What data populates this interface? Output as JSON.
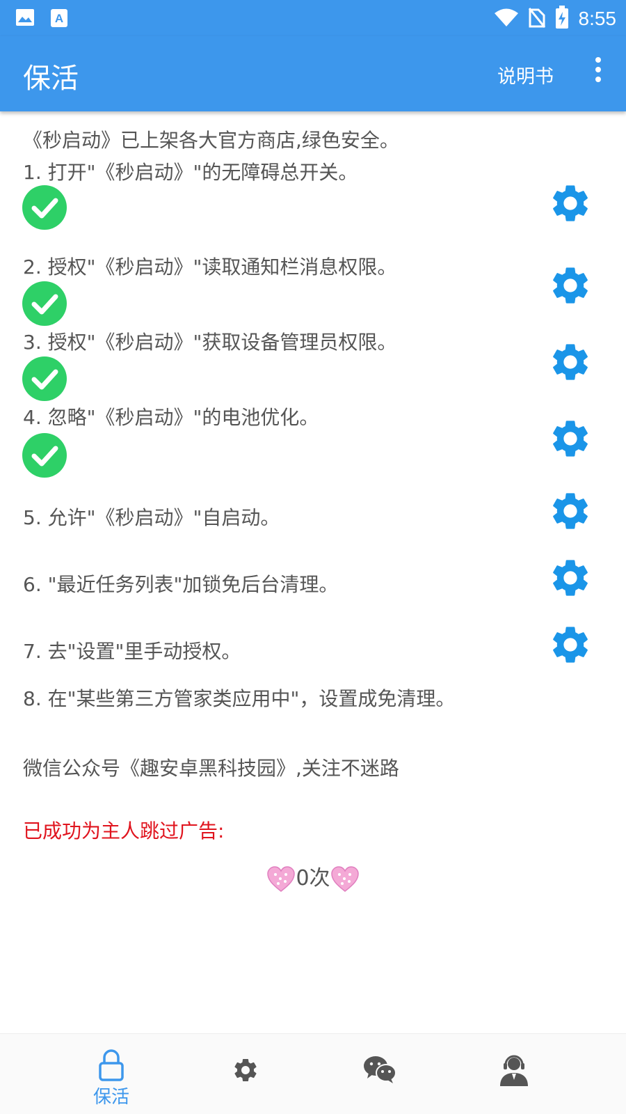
{
  "status_bar": {
    "time": "8:55",
    "icons": [
      "image-notification-icon",
      "font-notification-icon",
      "wifi-icon",
      "no-sim-icon",
      "battery-charging-icon"
    ]
  },
  "app_bar": {
    "title": "保活",
    "manual_label": "说明书",
    "more_icon": "more-vert-icon"
  },
  "content": {
    "intro": "《秒启动》已上架各大官方商店,绿色安全。",
    "steps": [
      {
        "label": "1. 打开\"《秒启动》\"的无障碍总开关。",
        "done": true
      },
      {
        "label": "2. 授权\"《秒启动》\"读取通知栏消息权限。",
        "done": true
      },
      {
        "label": "3. 授权\"《秒启动》\"获取设备管理员权限。",
        "done": true
      },
      {
        "label": "4. 忽略\"《秒启动》\"的电池优化。",
        "done": true
      },
      {
        "label": "5. 允许\"《秒启动》\"自启动。",
        "done": false
      },
      {
        "label": "6. \"最近任务列表\"加锁免后台清理。",
        "done": false
      },
      {
        "label": "7. 去\"设置\"里手动授权。",
        "done": false
      },
      {
        "label": "8. 在\"某些第三方管家类应用中\"，设置成免清理。",
        "done": false
      }
    ],
    "wechat_note": "微信公众号《趣安卓黑科技园》,关注不迷路",
    "skip_ads_label": "已成功为主人跳过广告:",
    "skip_count": "0次"
  },
  "colors": {
    "primary": "#3d97ec",
    "check_green": "#2ed067",
    "gear_blue": "#1a95e8",
    "alert_red": "#e0141e",
    "text_gray": "#555555"
  },
  "bottom_nav": {
    "items": [
      {
        "label": "保活",
        "icon": "lock-icon",
        "active": true
      },
      {
        "label": "",
        "icon": "gear-icon",
        "active": false
      },
      {
        "label": "",
        "icon": "wechat-icon",
        "active": false
      },
      {
        "label": "",
        "icon": "customer-service-icon",
        "active": false
      }
    ]
  }
}
